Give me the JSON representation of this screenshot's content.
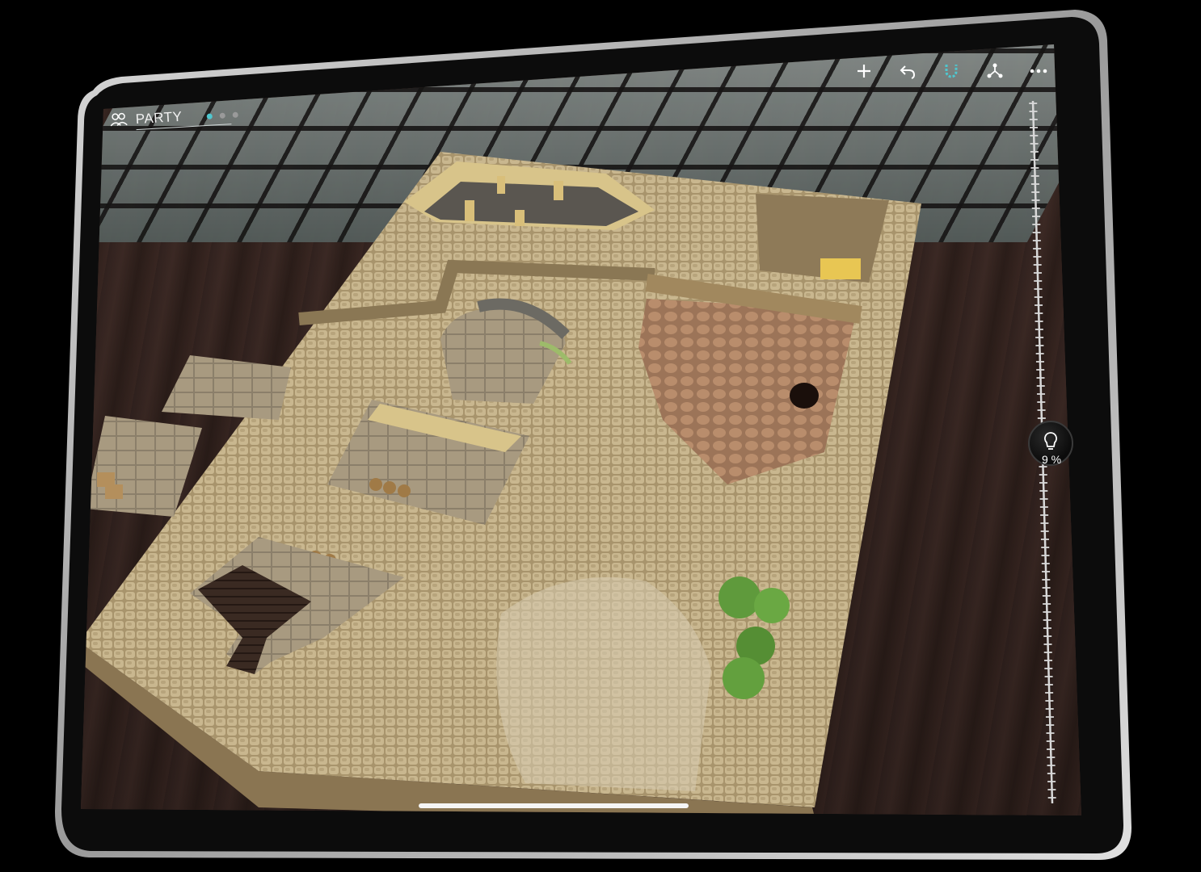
{
  "party": {
    "label": "PARTY",
    "page_indicator": {
      "count": 3,
      "active": 0
    }
  },
  "toolbar": {
    "add_icon": "plus-icon",
    "undo_icon": "undo-icon",
    "magnet_icon": "magnet-icon",
    "network_icon": "share-network-icon",
    "more_icon": "more-icon"
  },
  "light_slider": {
    "icon": "lightbulb-icon",
    "value_label": "9 %",
    "level": 0.09
  },
  "colors": {
    "accent": "#4fc7cf",
    "stone": "#b3a078",
    "grass": "#5f9a3c",
    "table_wood": "#3f2b26"
  }
}
